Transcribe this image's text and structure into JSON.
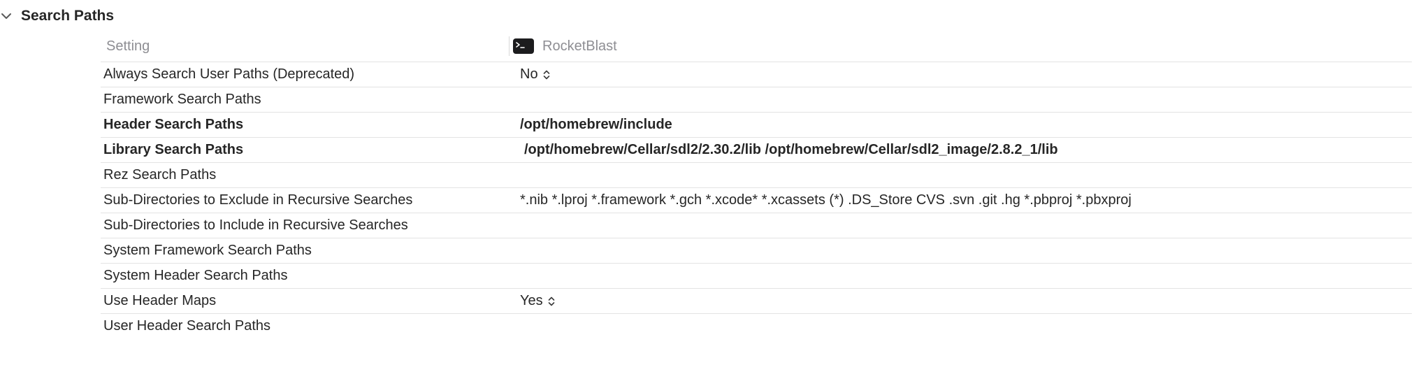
{
  "section": {
    "title": "Search Paths"
  },
  "table": {
    "setting_header": "Setting",
    "target_header": "RocketBlast",
    "rows": [
      {
        "name": "Always Search User Paths (Deprecated)",
        "value": "No",
        "bold": false,
        "popup": true
      },
      {
        "name": "Framework Search Paths",
        "value": "",
        "bold": false,
        "popup": false
      },
      {
        "name": "Header Search Paths",
        "value": "/opt/homebrew/include",
        "bold": true,
        "popup": false
      },
      {
        "name": "Library Search Paths",
        "value": "/opt/homebrew/Cellar/sdl2/2.30.2/lib /opt/homebrew/Cellar/sdl2_image/2.8.2_1/lib",
        "bold": true,
        "popup": false
      },
      {
        "name": "Rez Search Paths",
        "value": "",
        "bold": false,
        "popup": false
      },
      {
        "name": "Sub-Directories to Exclude in Recursive Searches",
        "value": "*.nib *.lproj *.framework *.gch *.xcode* *.xcassets (*) .DS_Store CVS .svn .git .hg *.pbproj *.pbxproj",
        "bold": false,
        "popup": false
      },
      {
        "name": "Sub-Directories to Include in Recursive Searches",
        "value": "",
        "bold": false,
        "popup": false
      },
      {
        "name": "System Framework Search Paths",
        "value": "",
        "bold": false,
        "popup": false
      },
      {
        "name": "System Header Search Paths",
        "value": "",
        "bold": false,
        "popup": false
      },
      {
        "name": "Use Header Maps",
        "value": "Yes",
        "bold": false,
        "popup": true
      },
      {
        "name": "User Header Search Paths",
        "value": "",
        "bold": false,
        "popup": false
      }
    ]
  },
  "icons": {
    "disclosure": "chevron-down-icon",
    "target": "terminal-icon",
    "popup": "up-down-chevron-icon"
  },
  "colors": {
    "text": "#262626",
    "secondary_text": "#8e8e93",
    "separator": "#e3e3e3",
    "terminal_bg": "#1c1c1e"
  }
}
